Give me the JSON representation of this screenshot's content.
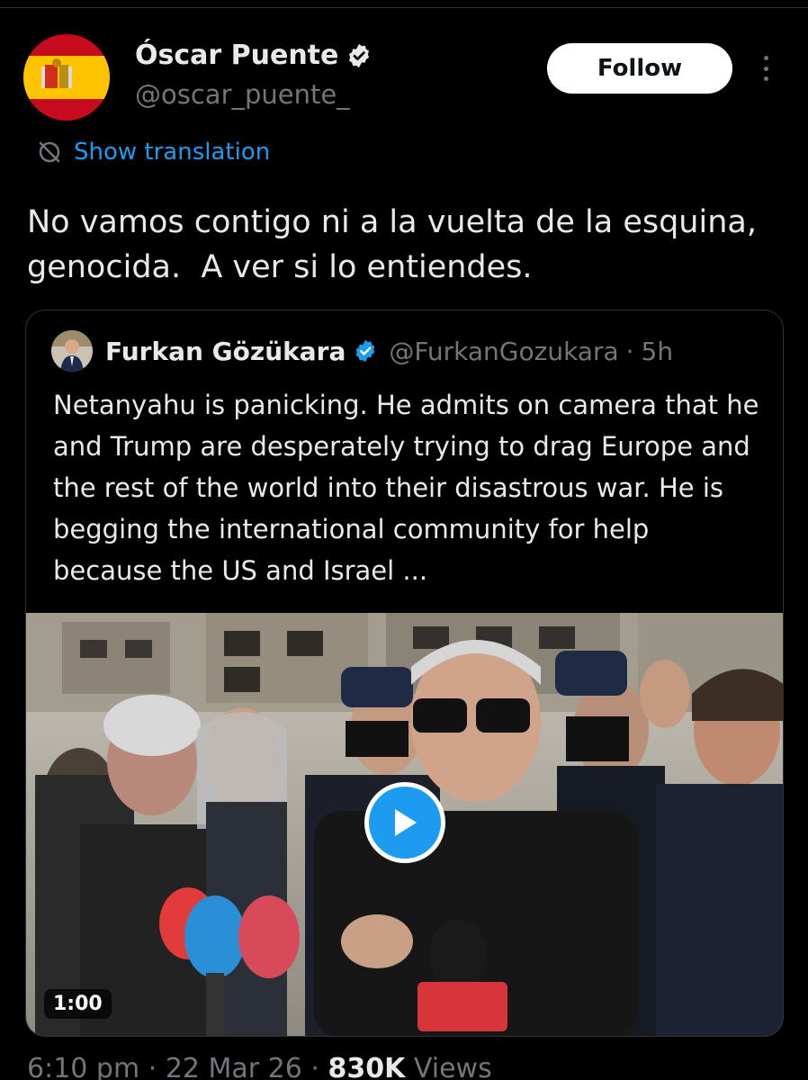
{
  "author": {
    "name": "Óscar Puente",
    "handle": "@oscar_puente_",
    "avatar_icon": "spain-flag-avatar",
    "verified": true
  },
  "actions": {
    "follow_label": "Follow",
    "more_icon": "more-vertical-icon"
  },
  "translation": {
    "label": "Show translation",
    "icon": "translate-icon"
  },
  "tweet": {
    "text": "No vamos contigo ni a la vuelta de la esquina, genocida.  A ver si lo entiendes."
  },
  "quote": {
    "author_name": "Furkan Gözükara",
    "handle": "@FurkanGozukara",
    "separator": "·",
    "time": "5h",
    "verified": true,
    "text": "Netanyahu is panicking. He admits on camera that he and Trump are desperately trying to drag Europe and the rest of the world into their disastrous war. He is begging the international community for help because the US and Israel ...",
    "media": {
      "type": "video",
      "duration": "1:00",
      "play_icon": "play-icon"
    }
  },
  "footer": {
    "time": "6:10 pm",
    "separator": "·",
    "date": "22 Mar 26",
    "views_count": "830K",
    "views_label": "Views"
  },
  "colors": {
    "background": "#000000",
    "accent": "#1d9bf0",
    "text": "#e7e9ea",
    "secondary": "#71767b",
    "border": "#2f3336"
  }
}
